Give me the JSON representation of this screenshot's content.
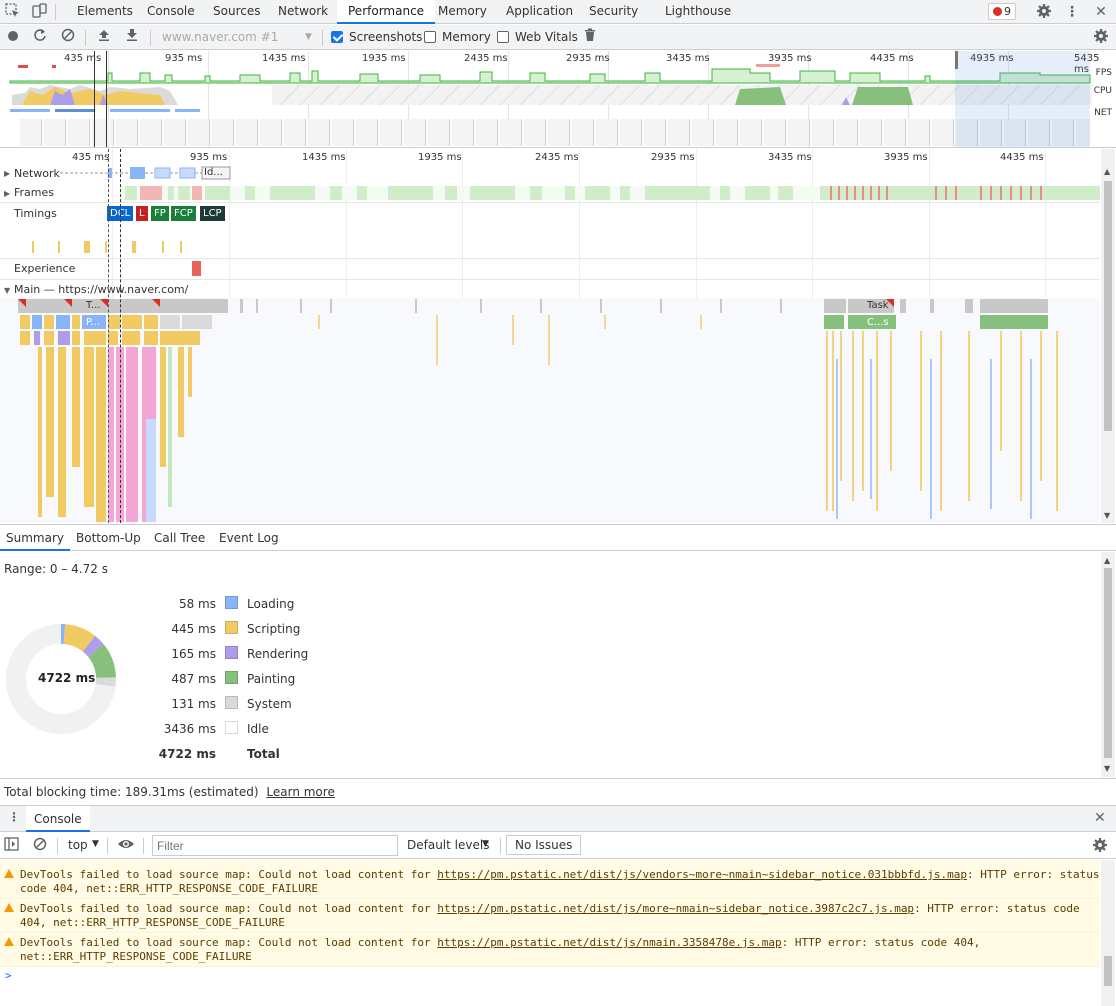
{
  "tabs": [
    "Elements",
    "Console",
    "Sources",
    "Network",
    "Performance",
    "Memory",
    "Application",
    "Security",
    "Lighthouse"
  ],
  "active_tab": "Performance",
  "error_count": "9",
  "perf_toolbar": {
    "profile_select": "www.naver.com #1",
    "screenshots_label": "Screenshots",
    "screenshots_checked": true,
    "memory_label": "Memory",
    "memory_checked": false,
    "webvitals_label": "Web Vitals",
    "webvitals_checked": false
  },
  "overview": {
    "ticks": [
      "435 ms",
      "935 ms",
      "1435 ms",
      "1935 ms",
      "2435 ms",
      "2935 ms",
      "3435 ms",
      "3935 ms",
      "4435 ms",
      "4935 ms",
      "5435 ms"
    ],
    "fps_label": "FPS",
    "cpu_label": "CPU",
    "net_label": "NET"
  },
  "flame": {
    "ticks": [
      "435 ms",
      "935 ms",
      "1435 ms",
      "1935 ms",
      "2435 ms",
      "2935 ms",
      "3435 ms",
      "3935 ms",
      "4435 ms"
    ],
    "tracks": {
      "network": "Network",
      "frames": "Frames",
      "timings": "Timings",
      "experience": "Experience",
      "main": "Main — https://www.naver.com/"
    },
    "timings": [
      {
        "label": "DCL",
        "color": "#0867cb"
      },
      {
        "label": "L",
        "color": "#c5221f"
      },
      {
        "label": "FP",
        "color": "#188038"
      },
      {
        "label": "FCP",
        "color": "#188038"
      },
      {
        "label": "LCP",
        "color": "#1e3a34"
      }
    ],
    "task_labels": [
      "T...",
      "P...",
      "Task",
      "C...s",
      "Id..."
    ]
  },
  "bottom_tabs": [
    "Summary",
    "Bottom-Up",
    "Call Tree",
    "Event Log"
  ],
  "summary": {
    "range": "Range: 0 – 4.72 s",
    "center": "4722 ms",
    "rows": [
      {
        "value": "58 ms",
        "name": "Loading",
        "color": "#8ab4f8"
      },
      {
        "value": "445 ms",
        "name": "Scripting",
        "color": "#f2ca63"
      },
      {
        "value": "165 ms",
        "name": "Rendering",
        "color": "#af9ceb"
      },
      {
        "value": "487 ms",
        "name": "Painting",
        "color": "#87c07d"
      },
      {
        "value": "131 ms",
        "name": "System",
        "color": "#dadada"
      },
      {
        "value": "3436 ms",
        "name": "Idle",
        "color": "#ffffff"
      }
    ],
    "total_value": "4722 ms",
    "total_label": "Total"
  },
  "tbt": {
    "text": "Total blocking time: 189.31ms (estimated)",
    "link": "Learn more"
  },
  "console": {
    "drawer_tab": "Console",
    "context": "top",
    "filter_placeholder": "Filter",
    "levels": "Default levels",
    "issues": "No Issues",
    "messages": [
      {
        "prefix": "DevTools failed to load source map: Could not load content for ",
        "url": "https://pm.pstatic.net/dist/js/vendors~more~nmain~sidebar_notice.031bbbfd.js.map",
        "suffix": ": HTTP error: status code 404, net::ERR_HTTP_RESPONSE_CODE_FAILURE"
      },
      {
        "prefix": "DevTools failed to load source map: Could not load content for ",
        "url": "https://pm.pstatic.net/dist/js/more~nmain~sidebar_notice.3987c2c7.js.map",
        "suffix": ": HTTP error: status code 404, net::ERR_HTTP_RESPONSE_CODE_FAILURE"
      },
      {
        "prefix": "DevTools failed to load source map: Could not load content for ",
        "url": "https://pm.pstatic.net/dist/js/nmain.3358478e.js.map",
        "suffix": ": HTTP error: status code 404, net::ERR_HTTP_RESPONSE_CODE_FAILURE"
      }
    ],
    "prompt": ">"
  }
}
